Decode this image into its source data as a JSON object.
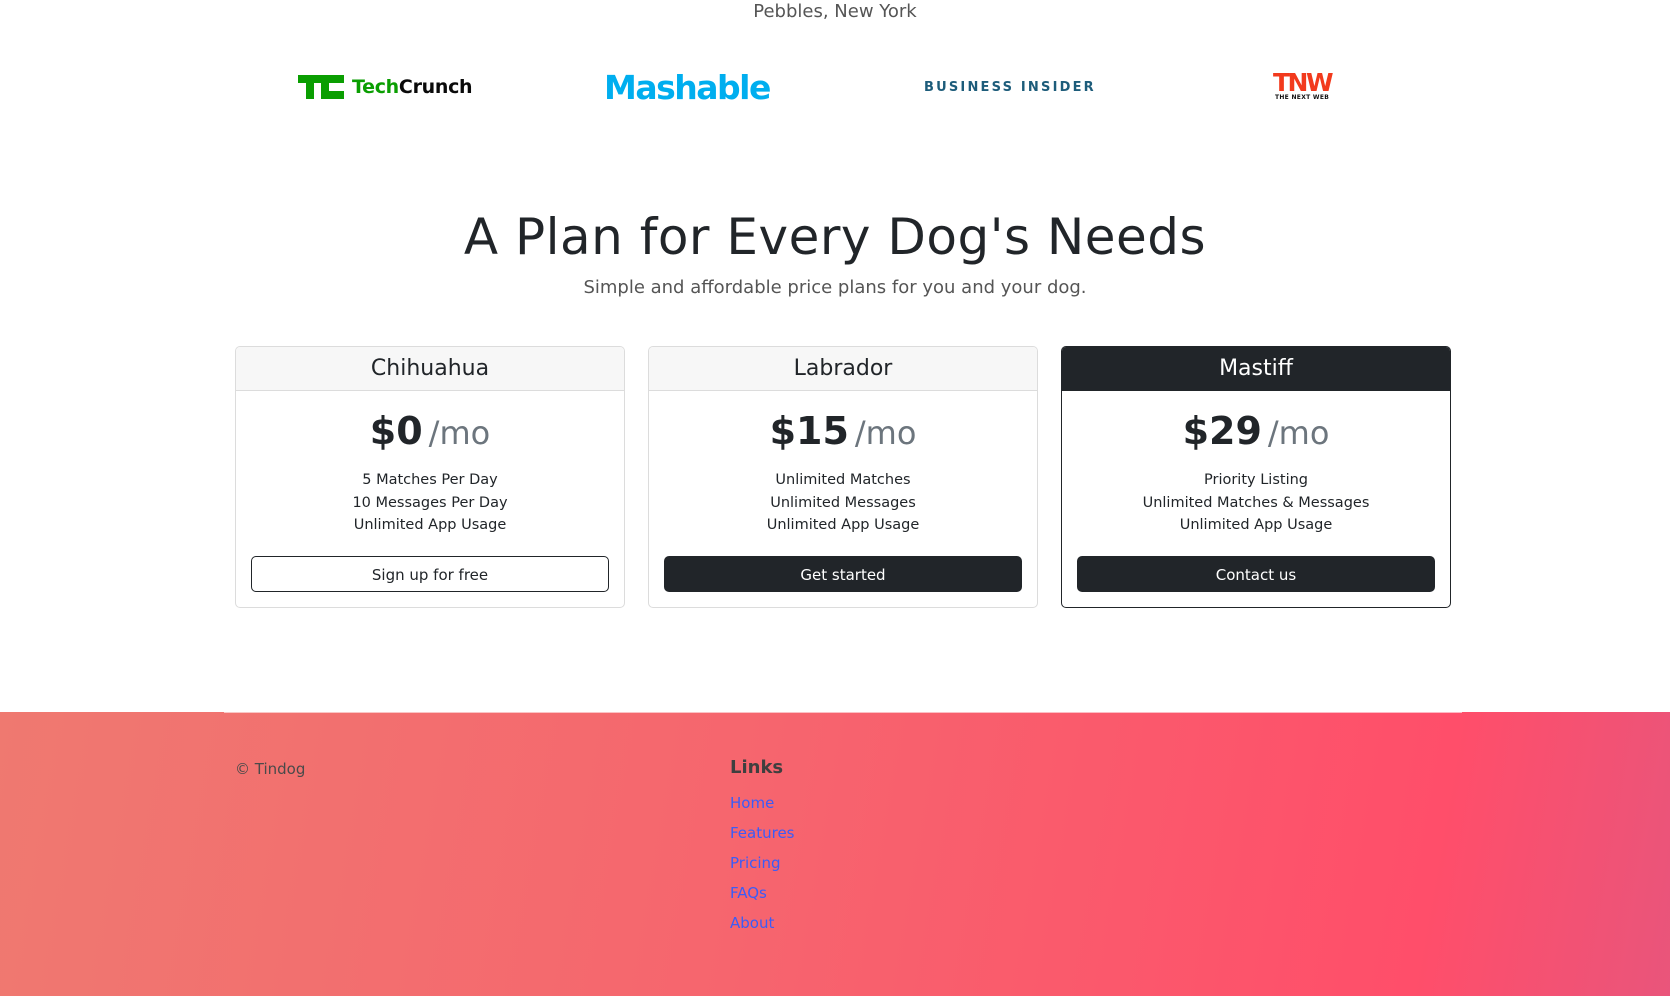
{
  "testimonial": {
    "author": "Pebbles, New York"
  },
  "press": {
    "techcrunch": {
      "mark": "TC",
      "name_prefix": "Tech",
      "name_suffix": "Crunch"
    },
    "mashable": {
      "name": "Mashable"
    },
    "business_insider": {
      "name": "BUSINESS INSIDER"
    },
    "tnw": {
      "name": "TNW",
      "sub": "THE NEXT WEB"
    }
  },
  "pricing": {
    "title": "A Plan for Every Dog's Needs",
    "subtitle": "Simple and affordable price plans for you and your dog.",
    "plans": [
      {
        "name": "Chihuahua",
        "price": "$0",
        "unit": "/mo",
        "features": [
          "5 Matches Per Day",
          "10 Messages Per Day",
          "Unlimited App Usage"
        ],
        "button": "Sign up for free"
      },
      {
        "name": "Labrador",
        "price": "$15",
        "unit": "/mo",
        "features": [
          "Unlimited Matches",
          "Unlimited Messages",
          "Unlimited App Usage"
        ],
        "button": "Get started"
      },
      {
        "name": "Mastiff",
        "price": "$29",
        "unit": "/mo",
        "features": [
          "Priority Listing",
          "Unlimited Matches & Messages",
          "Unlimited App Usage"
        ],
        "button": "Contact us"
      }
    ]
  },
  "footer": {
    "copyright": "© Tindog",
    "links_heading": "Links",
    "links": [
      "Home",
      "Features",
      "Pricing",
      "FAQs",
      "About"
    ]
  },
  "colors": {
    "dark": "#212529",
    "link": "#3b5cf7",
    "footer_gradient_start": "#ef7970",
    "footer_gradient_end": "#ff4e6a",
    "techcrunch_green": "#0a9e01",
    "mashable_blue": "#00aeef",
    "tnw_red": "#f23a1d"
  }
}
